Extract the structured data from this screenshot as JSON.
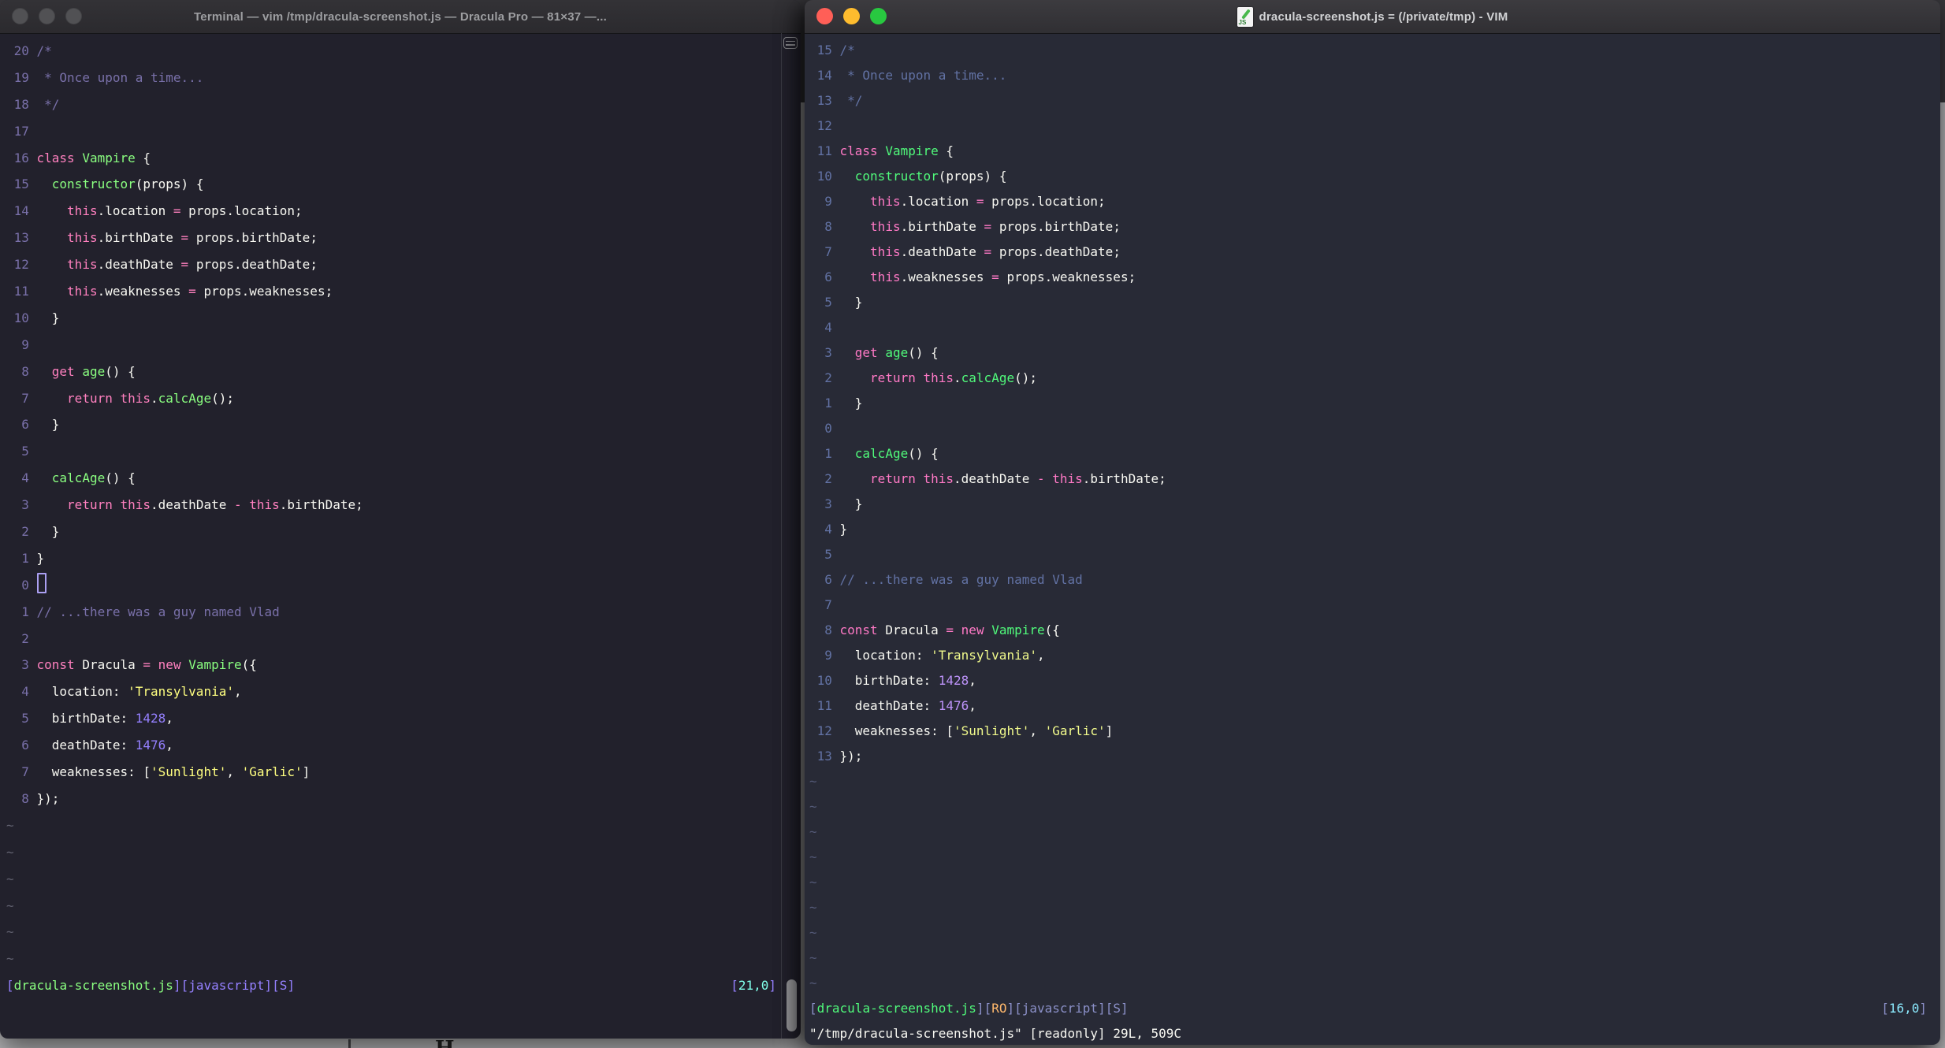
{
  "desktop": {
    "background": "#b7b7b9",
    "top_shade": "#38373b",
    "partial_glyph": "H"
  },
  "palette": {
    "left_theme": {
      "name": "Dracula Pro",
      "bg": "#22212C",
      "fg": "#F8F8F2",
      "comment": "#7970A9",
      "pink": "#FF80BF",
      "green": "#8AFF80",
      "purple": "#9580FF",
      "yellow": "#FFFF80",
      "cyan": "#80FFEA",
      "orange": "#FFCA80",
      "line_number": "#7970A9",
      "tilde": "#626270",
      "status_purple": "#9580FF"
    },
    "right_theme": {
      "name": "Dracula",
      "bg": "#282A36",
      "fg": "#F8F8F2",
      "comment": "#6272A4",
      "pink": "#FF79C6",
      "green": "#50FA7B",
      "purple": "#BD93F9",
      "yellow": "#F1FA8C",
      "cyan": "#8BE9FD",
      "orange": "#FFB86C",
      "line_number": "#6272A4",
      "tilde": "#545a78",
      "status_purple": "#8b90c8"
    }
  },
  "left_window": {
    "title": "Terminal — vim /tmp/dracula-screenshot.js — Dracula Pro — 81×37 —...",
    "controls": [
      "close",
      "minimize",
      "maximize"
    ],
    "cursor_line_index": 20,
    "tilde_count": 6,
    "status_left": [
      [
        "pb",
        "["
      ],
      [
        "gf",
        "dracula-screenshot.js"
      ],
      [
        "pb",
        "]["
      ],
      [
        "pl",
        "javascript"
      ],
      [
        "pb",
        "]["
      ],
      [
        "pl",
        "S"
      ],
      [
        "pb",
        "]"
      ]
    ],
    "status_right": [
      [
        "pb",
        "["
      ],
      [
        "cy",
        "21,0"
      ],
      [
        "pb",
        "]"
      ]
    ]
  },
  "right_window": {
    "title": "dracula-screenshot.js = (/private/tmp) - VIM",
    "controls": [
      "close",
      "minimize",
      "zoom"
    ],
    "tilde_count": 9,
    "status_left": [
      [
        "pb",
        "["
      ],
      [
        "gf",
        "dracula-screenshot.js"
      ],
      [
        "pb",
        "]["
      ],
      [
        "ol",
        "RO"
      ],
      [
        "pb",
        "]["
      ],
      [
        "pl",
        "javascript"
      ],
      [
        "pb",
        "]["
      ],
      [
        "pl",
        "S"
      ],
      [
        "pb",
        "]"
      ]
    ],
    "status_right": [
      [
        "pb",
        "["
      ],
      [
        "cy",
        "16,0"
      ],
      [
        "pb",
        "]"
      ]
    ],
    "command_line": "\"/tmp/dracula-screenshot.js\" [readonly] 29L, 509C"
  },
  "lines": [
    {
      "l": "20",
      "r": "15",
      "segments": [
        [
          "com",
          "/*"
        ]
      ]
    },
    {
      "l": "19",
      "r": "14",
      "segments": [
        [
          "com",
          " * Once upon a time..."
        ]
      ]
    },
    {
      "l": "18",
      "r": "13",
      "segments": [
        [
          "com",
          " */"
        ]
      ]
    },
    {
      "l": "17",
      "r": "12",
      "segments": []
    },
    {
      "l": "16",
      "r": "11",
      "segments": [
        [
          "kw",
          "class"
        ],
        [
          "fg",
          " "
        ],
        [
          "fn",
          "Vampire"
        ],
        [
          "fg",
          " {"
        ]
      ]
    },
    {
      "l": "15",
      "r": "10",
      "segments": [
        [
          "fg",
          "  "
        ],
        [
          "fn",
          "constructor"
        ],
        [
          "fg",
          "(props) {"
        ]
      ]
    },
    {
      "l": "14",
      "r": "9",
      "segments": [
        [
          "fg",
          "    "
        ],
        [
          "kw",
          "this"
        ],
        [
          "fg",
          ".location "
        ],
        [
          "kw",
          "="
        ],
        [
          "fg",
          " props.location;"
        ]
      ]
    },
    {
      "l": "13",
      "r": "8",
      "segments": [
        [
          "fg",
          "    "
        ],
        [
          "kw",
          "this"
        ],
        [
          "fg",
          ".birthDate "
        ],
        [
          "kw",
          "="
        ],
        [
          "fg",
          " props.birthDate;"
        ]
      ]
    },
    {
      "l": "12",
      "r": "7",
      "segments": [
        [
          "fg",
          "    "
        ],
        [
          "kw",
          "this"
        ],
        [
          "fg",
          ".deathDate "
        ],
        [
          "kw",
          "="
        ],
        [
          "fg",
          " props.deathDate;"
        ]
      ]
    },
    {
      "l": "11",
      "r": "6",
      "segments": [
        [
          "fg",
          "    "
        ],
        [
          "kw",
          "this"
        ],
        [
          "fg",
          ".weaknesses "
        ],
        [
          "kw",
          "="
        ],
        [
          "fg",
          " props.weaknesses;"
        ]
      ]
    },
    {
      "l": "10",
      "r": "5",
      "segments": [
        [
          "fg",
          "  }"
        ]
      ]
    },
    {
      "l": "9",
      "r": "4",
      "segments": []
    },
    {
      "l": "8",
      "r": "3",
      "segments": [
        [
          "fg",
          "  "
        ],
        [
          "kw",
          "get"
        ],
        [
          "fg",
          " "
        ],
        [
          "fn",
          "age"
        ],
        [
          "fg",
          "() {"
        ]
      ]
    },
    {
      "l": "7",
      "r": "2",
      "segments": [
        [
          "fg",
          "    "
        ],
        [
          "kw",
          "return"
        ],
        [
          "fg",
          " "
        ],
        [
          "kw",
          "this"
        ],
        [
          "fg",
          "."
        ],
        [
          "fn",
          "calcAge"
        ],
        [
          "fg",
          "();"
        ]
      ]
    },
    {
      "l": "6",
      "r": "1",
      "segments": [
        [
          "fg",
          "  }"
        ]
      ]
    },
    {
      "l": "5",
      "r": "0",
      "segments": []
    },
    {
      "l": "4",
      "r": "1",
      "segments": [
        [
          "fg",
          "  "
        ],
        [
          "fn",
          "calcAge"
        ],
        [
          "fg",
          "() {"
        ]
      ]
    },
    {
      "l": "3",
      "r": "2",
      "segments": [
        [
          "fg",
          "    "
        ],
        [
          "kw",
          "return"
        ],
        [
          "fg",
          " "
        ],
        [
          "kw",
          "this"
        ],
        [
          "fg",
          ".deathDate "
        ],
        [
          "kw",
          "-"
        ],
        [
          "fg",
          " "
        ],
        [
          "kw",
          "this"
        ],
        [
          "fg",
          ".birthDate;"
        ]
      ]
    },
    {
      "l": "2",
      "r": "3",
      "segments": [
        [
          "fg",
          "  }"
        ]
      ]
    },
    {
      "l": "1",
      "r": "4",
      "segments": [
        [
          "fg",
          "}"
        ]
      ]
    },
    {
      "l": "0",
      "r": "5",
      "segments": []
    },
    {
      "l": "1",
      "r": "6",
      "segments": [
        [
          "com",
          "// ...there was a guy named Vlad"
        ]
      ]
    },
    {
      "l": "2",
      "r": "7",
      "segments": []
    },
    {
      "l": "3",
      "r": "8",
      "segments": [
        [
          "kw",
          "const"
        ],
        [
          "fg",
          " Dracula "
        ],
        [
          "kw",
          "="
        ],
        [
          "fg",
          " "
        ],
        [
          "kw",
          "new"
        ],
        [
          "fg",
          " "
        ],
        [
          "fn",
          "Vampire"
        ],
        [
          "fg",
          "({"
        ]
      ]
    },
    {
      "l": "4",
      "r": "9",
      "segments": [
        [
          "fg",
          "  location: "
        ],
        [
          "str",
          "'Transylvania'"
        ],
        [
          "fg",
          ","
        ]
      ]
    },
    {
      "l": "5",
      "r": "10",
      "segments": [
        [
          "fg",
          "  birthDate: "
        ],
        [
          "num",
          "1428"
        ],
        [
          "fg",
          ","
        ]
      ]
    },
    {
      "l": "6",
      "r": "11",
      "segments": [
        [
          "fg",
          "  deathDate: "
        ],
        [
          "num",
          "1476"
        ],
        [
          "fg",
          ","
        ]
      ]
    },
    {
      "l": "7",
      "r": "12",
      "segments": [
        [
          "fg",
          "  weaknesses: ["
        ],
        [
          "str",
          "'Sunlight'"
        ],
        [
          "fg",
          ", "
        ],
        [
          "str",
          "'Garlic'"
        ],
        [
          "fg",
          "]"
        ]
      ]
    },
    {
      "l": "8",
      "r": "13",
      "segments": [
        [
          "fg",
          "});"
        ]
      ]
    }
  ]
}
